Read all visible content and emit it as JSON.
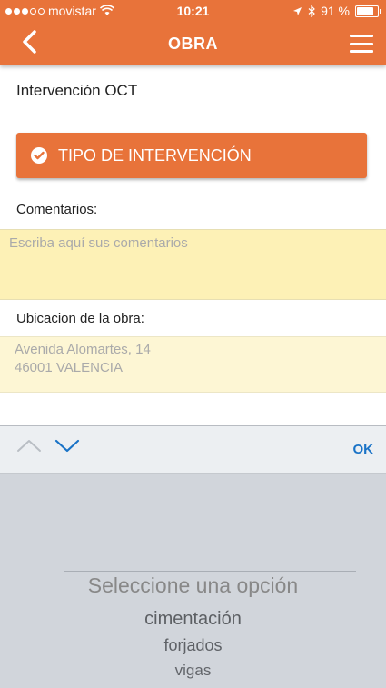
{
  "status_bar": {
    "carrier": "movistar",
    "time": "10:21",
    "battery": "91 %",
    "battery_level": 0.91
  },
  "nav": {
    "title": "OBRA"
  },
  "main": {
    "section_title": "Intervención OCT",
    "type_button_label": "TIPO DE INTERVENCIÓN",
    "comments_label": "Comentarios:",
    "comments_placeholder": "Escriba aquí sus comentarios",
    "location_label": "Ubicacion de la obra:",
    "location_line1": "Avenida Alomartes, 14",
    "location_line2": "46001 VALENCIA"
  },
  "picker": {
    "ok_label": "OK",
    "options": [
      "Seleccione una opción",
      "cimentación",
      "forjados",
      "vigas"
    ]
  },
  "colors": {
    "accent": "#e8733a",
    "highlight_field": "#fdf1b6",
    "link_blue": "#1a73c7"
  }
}
